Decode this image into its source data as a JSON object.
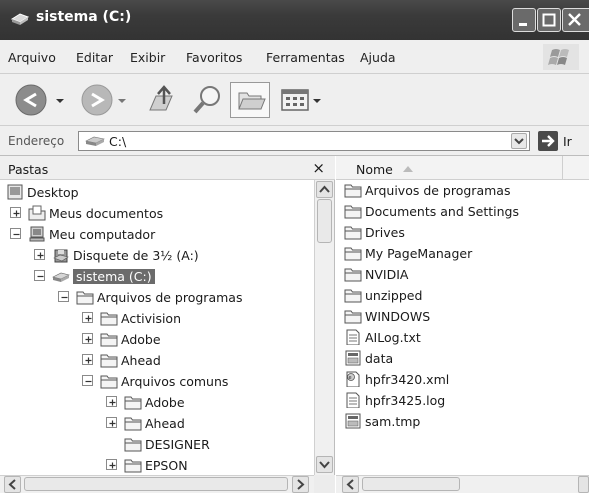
{
  "window": {
    "title": "sistema (C:)"
  },
  "menubar": {
    "items": [
      "Arquivo",
      "Editar",
      "Exibir",
      "Favoritos",
      "Ferramentas",
      "Ajuda"
    ]
  },
  "address": {
    "label": "Endereço",
    "value": "C:\\",
    "go_label": "Ir"
  },
  "folders_pane": {
    "title": "Pastas",
    "close_glyph": "×",
    "tree": [
      {
        "label": "Desktop",
        "expander": "none",
        "icon": "desktop-icon"
      },
      {
        "label": "Meus documentos",
        "expander": "plus",
        "icon": "documents-icon"
      },
      {
        "label": "Meu computador",
        "expander": "minus",
        "icon": "computer-icon"
      },
      {
        "label": "Disquete de 3½ (A:)",
        "expander": "plus",
        "icon": "floppy-icon"
      },
      {
        "label": "sistema (C:)",
        "expander": "minus",
        "icon": "drive-icon",
        "selected": true
      },
      {
        "label": "Arquivos de programas",
        "expander": "minus",
        "icon": "folder-icon"
      },
      {
        "label": "Activision",
        "expander": "plus",
        "icon": "folder-icon"
      },
      {
        "label": "Adobe",
        "expander": "plus",
        "icon": "folder-icon"
      },
      {
        "label": "Ahead",
        "expander": "plus",
        "icon": "folder-icon"
      },
      {
        "label": "Arquivos comuns",
        "expander": "minus",
        "icon": "folder-icon"
      },
      {
        "label": "Adobe",
        "expander": "plus",
        "icon": "folder-icon"
      },
      {
        "label": "Ahead",
        "expander": "plus",
        "icon": "folder-icon"
      },
      {
        "label": "DESIGNER",
        "expander": "none",
        "icon": "folder-icon"
      },
      {
        "label": "EPSON",
        "expander": "plus",
        "icon": "folder-icon"
      }
    ]
  },
  "files_pane": {
    "column_name": "Nome",
    "items": [
      {
        "label": "Arquivos de programas",
        "icon": "folder-icon"
      },
      {
        "label": "Documents and Settings",
        "icon": "folder-icon"
      },
      {
        "label": "Drives",
        "icon": "folder-icon"
      },
      {
        "label": "My PageManager",
        "icon": "folder-icon"
      },
      {
        "label": "NVIDIA",
        "icon": "folder-icon"
      },
      {
        "label": "unzipped",
        "icon": "folder-icon"
      },
      {
        "label": "WINDOWS",
        "icon": "folder-icon"
      },
      {
        "label": "AILog.txt",
        "icon": "text-file-icon"
      },
      {
        "label": "data",
        "icon": "system-file-icon"
      },
      {
        "label": "hpfr3420.xml",
        "icon": "xml-file-icon"
      },
      {
        "label": "hpfr3425.log",
        "icon": "text-file-icon"
      },
      {
        "label": "sam.tmp",
        "icon": "system-file-icon"
      }
    ]
  }
}
